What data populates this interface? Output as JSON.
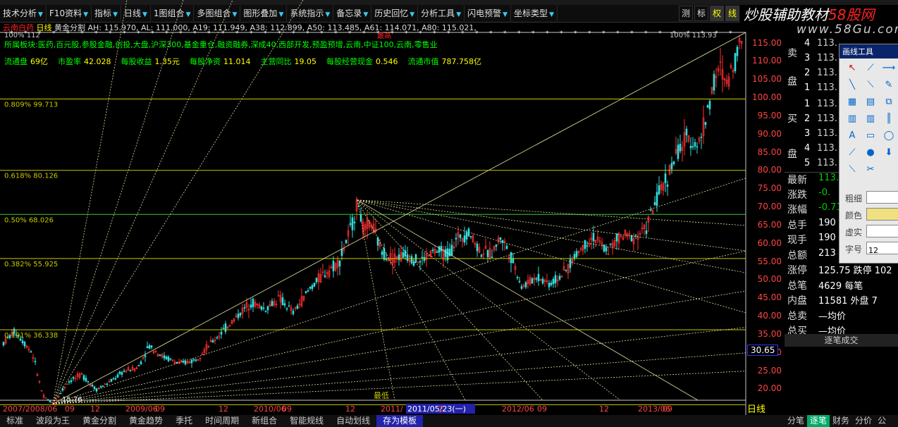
{
  "toolbar": {
    "items": [
      "技术分析",
      "F10资料",
      "指标",
      "日线",
      "1图组合",
      "多图组合",
      "图形叠加",
      "系统指示",
      "备忘录",
      "历史回忆",
      "分析工具",
      "闪电预警",
      "坐标类型"
    ],
    "right_buttons": [
      "测",
      "标",
      "权",
      "线"
    ]
  },
  "watermark": {
    "text_white": "炒股辅助教材",
    "text_red": "58股网",
    "url": "www.58Gu.com"
  },
  "info": {
    "stock": "云南白药",
    "period": "日线",
    "indicator_line": "黄金分割  AH: 115.970, AL: 111.000, A19: 111.949, A38: 112.899, A50: 113.485, A61: 114.071, A80: 115.021,",
    "sector_prefix": "所属板块:",
    "sectors": "医药,百元股,参股金融,创投,大盘,沪深300,基金重仓,融资融券,深成40,西部开发,预盈预增,云南,中证100,云南,零售业",
    "finance": [
      {
        "label": "流通盘",
        "value": "69亿"
      },
      {
        "label": "市盈率",
        "value": "42.028"
      },
      {
        "label": "每股收益",
        "value": "1.35元"
      },
      {
        "label": "每股净资",
        "value": "11.014"
      },
      {
        "label": "主营同比",
        "value": "19.05"
      },
      {
        "label": "每股经营现金",
        "value": "0.546"
      },
      {
        "label": "流通市值",
        "value": "787.758亿"
      }
    ]
  },
  "gold_lines": [
    {
      "label": "0.809%  99.713",
      "price": 99.713
    },
    {
      "label": "0.618%  80.126",
      "price": 80.126
    },
    {
      "label": "0.50%   68.026",
      "price": 68.026
    },
    {
      "label": "0.382%  55.925",
      "price": 55.925
    },
    {
      "label": "0.191%  36.338",
      "price": 36.338
    }
  ],
  "top_labels": {
    "left": "100%  112",
    "right": "100%  113.93"
  },
  "price_axis": {
    "ticks": [
      "115.00",
      "110.00",
      "105.00",
      "100.00",
      "95.00",
      "90.00",
      "85.00",
      "80.00",
      "75.00",
      "70.00",
      "65.00",
      "60.00",
      "55.00",
      "50.00",
      "45.00",
      "40.00",
      "35.00",
      "30.00",
      "25.00",
      "20.00"
    ],
    "current": "30.65",
    "ymin": 17,
    "ymax": 118
  },
  "date_axis": {
    "labels": [
      "2007/2008/06",
      "09",
      "12",
      "2009/06",
      "09",
      "12",
      "2010/06",
      "09",
      "12",
      "2011/",
      "2011/05/23(一)",
      "2",
      "2012/06",
      "09",
      "12",
      "2013/06",
      "09"
    ],
    "period_label": "日线"
  },
  "chart_labels": {
    "low": "最低",
    "lowval": "15.76",
    "peak": "最高"
  },
  "orderbook": {
    "sell_label": [
      "卖",
      "盘"
    ],
    "buy_label": [
      "买",
      "盘"
    ],
    "sell": [
      {
        "n": "4",
        "v": "113."
      },
      {
        "n": "3",
        "v": "113."
      },
      {
        "n": "2",
        "v": "113."
      },
      {
        "n": "1",
        "v": "113."
      }
    ],
    "buy": [
      {
        "n": "1",
        "v": "113."
      },
      {
        "n": "2",
        "v": "113."
      },
      {
        "n": "3",
        "v": "113."
      },
      {
        "n": "4",
        "v": "113."
      },
      {
        "n": "5",
        "v": "113."
      }
    ]
  },
  "quote": [
    {
      "label": "最新",
      "value": "113."
    },
    {
      "label": "涨跌",
      "value": "-0."
    },
    {
      "label": "涨幅",
      "value": "-0.71"
    },
    {
      "label": "总手",
      "value": "190"
    },
    {
      "label": "现手",
      "value": "190"
    },
    {
      "label": "总额",
      "value": "213"
    },
    {
      "label": "涨停",
      "value": "125.75 跌停  102"
    },
    {
      "label": "总笔",
      "value": "4629 每笔"
    },
    {
      "label": "内盘",
      "value": "11581 外盘   7"
    },
    {
      "label": "总卖",
      "value": "—均价"
    },
    {
      "label": "总买",
      "value": "—均价"
    }
  ],
  "tick_header": "逐笔成交",
  "draw_tools": {
    "title": "画线工具",
    "rows": [
      "粗细",
      "颜色",
      "虚实",
      "字号"
    ],
    "font_size": "12"
  },
  "bottom_tabs": [
    "标准",
    "波段为王",
    "黄金分割",
    "黄金趋势",
    "季托",
    "时间周期",
    "新组合",
    "智能规线",
    "自动划线",
    "存为模板"
  ],
  "bottom_tabs_on": "存为模板",
  "right_tabs": [
    "分笔",
    "逐笔",
    "财务",
    "分价",
    "公"
  ],
  "right_tabs_on": "逐笔",
  "colors": {
    "up": "#ff3030",
    "down": "#30e0e0",
    "gold": "#c8c800",
    "fan": "#f0f080"
  }
}
